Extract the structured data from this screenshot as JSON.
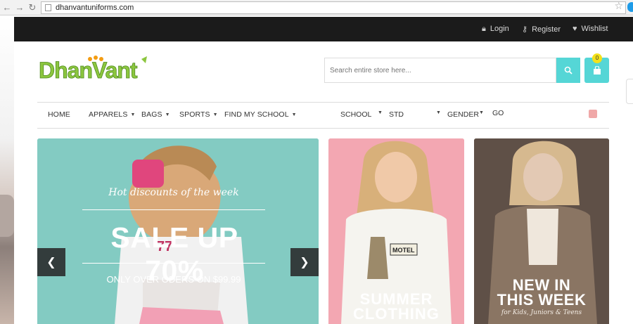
{
  "browser": {
    "url": "dhanvantuniforms.com"
  },
  "topbar": {
    "login": "Login",
    "register": "Register",
    "wishlist": "Wishlist"
  },
  "header": {
    "logo_text": "DhanVant",
    "search_placeholder": "Search entire store here...",
    "cart_count": "0",
    "accent_color": "#55d6d6"
  },
  "nav": {
    "items": [
      {
        "label": "HOME",
        "dropdown": false
      },
      {
        "label": "APPARELS",
        "dropdown": true
      },
      {
        "label": "BAGS",
        "dropdown": true
      },
      {
        "label": "SPORTS",
        "dropdown": true
      },
      {
        "label": "FIND MY SCHOOL",
        "dropdown": true
      }
    ],
    "filters": {
      "school": "SCHOOL",
      "std": "STD",
      "gender": "GENDER",
      "go": "GO"
    }
  },
  "slider": {
    "caption": "Hot discounts of the week",
    "headline": "SALE UP 70%",
    "subline": "ONLY OVER ODERS ON $99.99",
    "prev_icon": "chevron-left-icon",
    "next_icon": "chevron-right-icon"
  },
  "banner_summer": {
    "title_line1": "SUMMER",
    "title_line2": "CLOTHING",
    "shirt_text": "MOTEL"
  },
  "banner_new": {
    "title_line1": "NEW IN",
    "title_line2": "THIS WEEK",
    "subtitle": "for Kids, Juniors & Teens"
  }
}
